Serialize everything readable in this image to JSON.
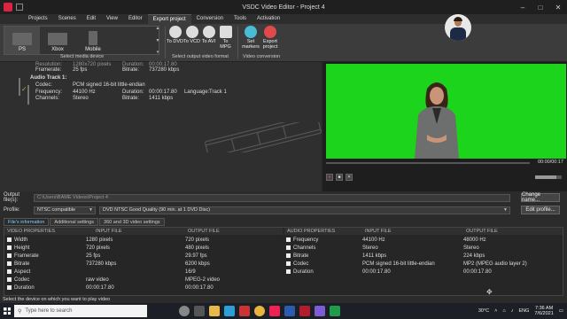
{
  "window": {
    "title": "VSDC Video Editor - Project 4",
    "minimize": "–",
    "maximize": "□",
    "close": "✕"
  },
  "menu": {
    "tabs": [
      {
        "label": "Projects"
      },
      {
        "label": "Scenes"
      },
      {
        "label": "Edit"
      },
      {
        "label": "View"
      },
      {
        "label": "Editor"
      },
      {
        "label": "Export project"
      },
      {
        "label": "Conversion"
      },
      {
        "label": "Tools"
      },
      {
        "label": "Activation"
      }
    ],
    "active": "Export project"
  },
  "ribbon": {
    "devices": [
      {
        "label": "PS"
      },
      {
        "label": "Xbox"
      },
      {
        "label": "Mobile"
      }
    ],
    "device_group_label": "Select media device",
    "formats": [
      {
        "label": "To DVD",
        "icon": "dvd-icon"
      },
      {
        "label": "To VCD",
        "icon": "vcd-icon"
      },
      {
        "label": "To AVI",
        "icon": "avi-icon"
      },
      {
        "label": "To MPG",
        "icon": "mpg-icon"
      }
    ],
    "format_group_label": "Select output video format",
    "conversion": [
      {
        "label": "Set markers",
        "icon": "markers-icon"
      },
      {
        "label": "Export project",
        "icon": "export-icon"
      }
    ],
    "conversion_group_label": "Video conversion"
  },
  "info": {
    "resolution_label": "Resolution:",
    "resolution_value": "1280x720 pixels",
    "duration_label": "Duration:",
    "duration_value": "00:00:17.80",
    "framerate_label": "Framerate:",
    "framerate_value": "25 fps",
    "bitrate_label": "Bitrate:",
    "bitrate_value": "737280 kbps",
    "audio_title": "Audio Track 1:",
    "codec_label": "Codec:",
    "codec_value": "PCM signed 16-bit little-endian",
    "frequency_label": "Frequency:",
    "frequency_value": "44100 Hz",
    "audio_duration_label": "Duration:",
    "audio_duration_value": "00:00:17.80",
    "language_label": "Language:",
    "language_value": "Track 1",
    "channels_label": "Channels:",
    "channels_value": "Stereo",
    "audio_bitrate_label": "Bitrate:",
    "audio_bitrate_value": "1411 kbps"
  },
  "preview": {
    "timecode": "00:00/00:17",
    "playback_fraction": 0.0,
    "volume_fraction": 0.8
  },
  "output": {
    "file_label": "Output file(s):",
    "file_value": "C:\\Users\\BAME Videos\\Project 4",
    "change_name": "Change name...",
    "profile_label": "Profile:",
    "profile_value": "NTSC compatible",
    "quality_value": "DVD NTSC Good Quality (90 min. at 1 DVD Disc)",
    "edit_profile": "Edit profile..."
  },
  "panel_tabs": [
    {
      "label": "File's information"
    },
    {
      "label": "Additional settings"
    },
    {
      "label": "360 and 3D video settings"
    }
  ],
  "video_props": {
    "headers": [
      "VIDEO PROPERTIES",
      "INPUT FILE",
      "OUTPUT FILE"
    ],
    "rows": [
      {
        "name": "Width",
        "input": "1280 pixels",
        "output": "720 pixels"
      },
      {
        "name": "Height",
        "input": "720 pixels",
        "output": "480 pixels"
      },
      {
        "name": "Framerate",
        "input": "25 fps",
        "output": "29.97 fps"
      },
      {
        "name": "Bitrate",
        "input": "737280 kbps",
        "output": "6200 kbps"
      },
      {
        "name": "Aspect",
        "input": "",
        "output": "16/9"
      },
      {
        "name": "Codec",
        "input": "raw video",
        "output": "MPEG-2 video"
      },
      {
        "name": "Duration",
        "input": "00:00:17.80",
        "output": "00:00:17.80"
      }
    ]
  },
  "audio_props": {
    "headers": [
      "AUDIO PROPERTIES",
      "INPUT FILE",
      "OUTPUT FILE"
    ],
    "rows": [
      {
        "name": "Frequency",
        "input": "44100 Hz",
        "output": "48000 Hz"
      },
      {
        "name": "Channels",
        "input": "Stereo",
        "output": "Stereo"
      },
      {
        "name": "Bitrate",
        "input": "1411 kbps",
        "output": "224 kbps"
      },
      {
        "name": "Codec",
        "input": "PCM signed 16-bit little-endian",
        "output": "MP2 (MPEG audio layer 2)"
      },
      {
        "name": "Duration",
        "input": "00:00:17.80",
        "output": "00:00:17.80"
      }
    ]
  },
  "status": "Select the device on which you want to play video",
  "taskbar": {
    "search_placeholder": "Type here to search",
    "weather": "30°C",
    "language": "ENG",
    "time": "7:36 AM",
    "date": "7/6/2021"
  }
}
